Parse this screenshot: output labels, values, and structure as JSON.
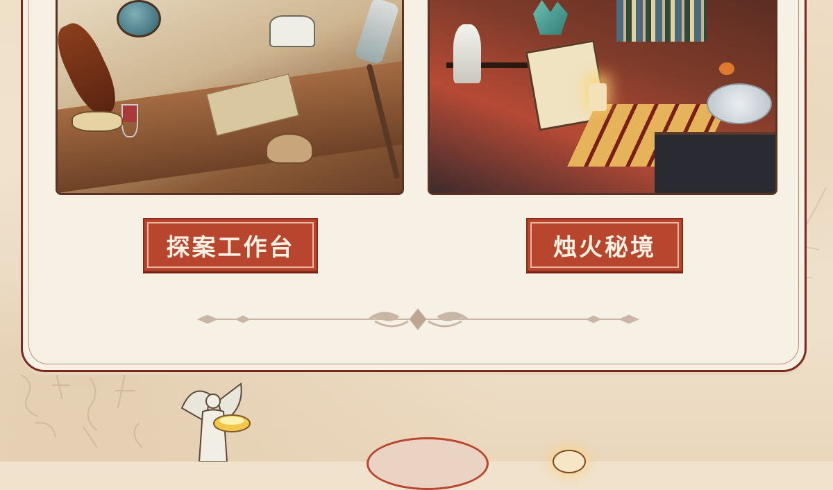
{
  "scenes": [
    {
      "id": "detective-desk",
      "label": "探案工作台"
    },
    {
      "id": "candle-realm",
      "label": "烛火秘境"
    }
  ],
  "colors": {
    "accent_red": "#b8452e",
    "border_brown": "#7a2a1c",
    "card_bg": "#f7f0e4",
    "page_bg": "#f0e2cc"
  },
  "icons": {
    "divider": "ornamental-divider-icon",
    "angel": "angel-statue-icon",
    "candle": "candle-icon"
  }
}
